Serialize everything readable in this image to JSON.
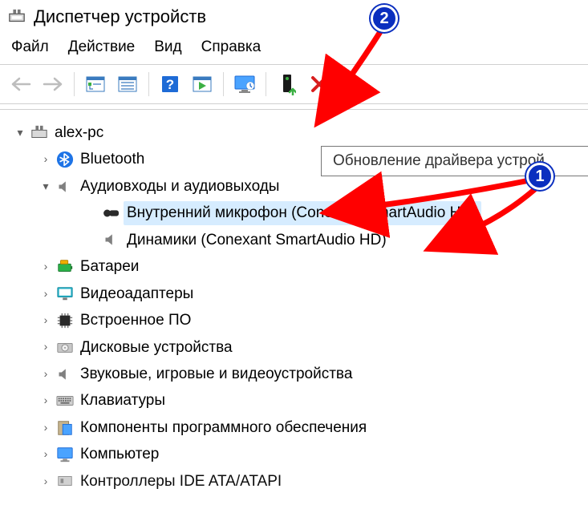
{
  "window": {
    "title": "Диспетчер устройств"
  },
  "menu": {
    "file": "Файл",
    "action": "Действие",
    "view": "Вид",
    "help": "Справка"
  },
  "tooltip": {
    "update_driver": "Обновление драйвера устрой"
  },
  "tree": {
    "root": "alex-pc",
    "bluetooth": "Bluetooth",
    "audio": "Аудиовходы и аудиовыходы",
    "audio_mic": "Внутренний микрофон (Conexant SmartAudio HD)",
    "audio_speakers": "Динамики (Conexant SmartAudio HD)",
    "batteries": "Батареи",
    "display_adapters": "Видеоадаптеры",
    "firmware": "Встроенное ПО",
    "disk_drives": "Дисковые устройства",
    "sound_video_game": "Звуковые, игровые и видеоустройства",
    "keyboards": "Клавиатуры",
    "software_components": "Компоненты программного обеспечения",
    "computer": "Компьютер",
    "ide_ata_atapi": "Контроллеры IDE ATA/ATAPI"
  },
  "annotations": {
    "badge1": "1",
    "badge2": "2"
  }
}
